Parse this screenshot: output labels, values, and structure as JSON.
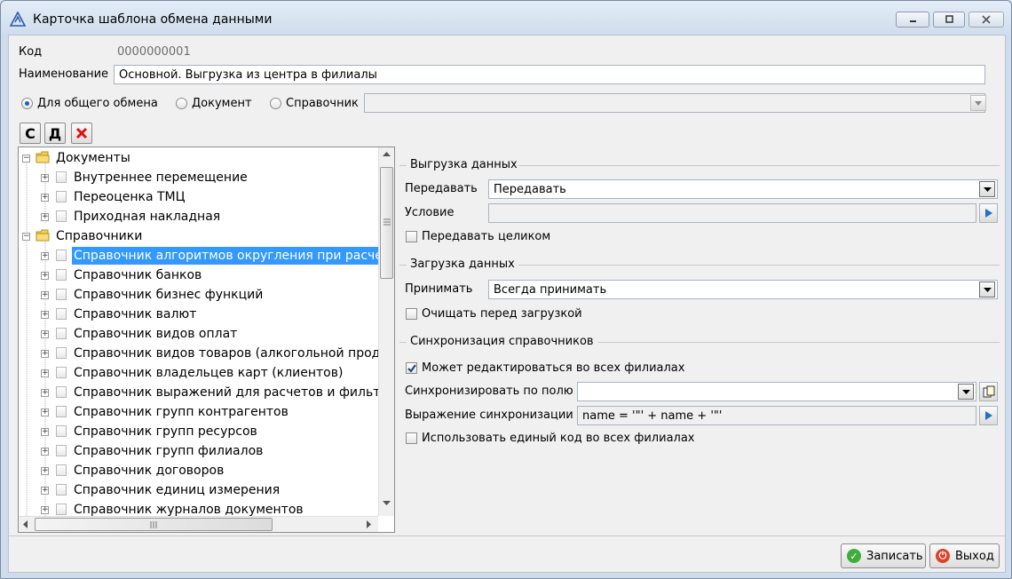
{
  "window": {
    "title": "Карточка шаблона обмена данными"
  },
  "header": {
    "code_label": "Код",
    "code_value": "0000000001",
    "name_label": "Наименование",
    "name_value": "Основной. Выгрузка из центра в филиалы"
  },
  "scope": {
    "options": [
      "Для общего обмена",
      "Документ",
      "Справочник"
    ],
    "selected": "Для общего обмена",
    "combo_value": ""
  },
  "toolbar": {
    "create_label": "С",
    "delete_label": "Д",
    "remove_icon": "x-icon"
  },
  "tree": {
    "groups": [
      {
        "label": "Документы",
        "items": [
          "Внутреннее перемещение",
          "Переоценка ТМЦ",
          "Приходная накладная"
        ]
      },
      {
        "label": "Справочники",
        "items": [
          "Справочник алгоритмов округления при расчетах",
          "Справочник банков",
          "Справочник бизнес функций",
          "Справочник валют",
          "Справочник видов оплат",
          "Справочник видов товаров (алкогольной продукции)",
          "Справочник владельцев карт (клиентов)",
          "Справочник выражений для расчетов и фильтров",
          "Справочник групп контрагентов",
          "Справочник групп ресурсов",
          "Справочник групп филиалов",
          "Справочник договоров",
          "Справочник единиц измерения",
          "Справочник журналов документов"
        ]
      }
    ],
    "selected_item": "Справочник алгоритмов округления при расчетах"
  },
  "export": {
    "section_title": "Выгрузка данных",
    "transfer_label": "Передавать",
    "transfer_value": "Передавать",
    "condition_label": "Условие",
    "condition_value": "",
    "whole_label": "Передавать целиком",
    "whole_checked": false
  },
  "import": {
    "section_title": "Загрузка данных",
    "accept_label": "Принимать",
    "accept_value": "Всегда принимать",
    "clear_label": "Очищать перед загрузкой",
    "clear_checked": false
  },
  "sync": {
    "section_title": "Синхронизация справочников",
    "editable_label": "Может редактироваться во всех филиалах",
    "editable_checked": true,
    "field_label": "Синхронизировать по полю",
    "field_value": "",
    "expr_label": "Выражение синхронизации",
    "expr_value": "name = '\"' + name + '\"'",
    "single_code_label": "Использовать единый код во всех филиалах",
    "single_code_checked": false
  },
  "actions": {
    "save_label": "Записать",
    "exit_label": "Выход"
  },
  "colors": {
    "selection": "#3399ff",
    "save_icon": "#3fae3f",
    "exit_icon": "#d9442b"
  }
}
